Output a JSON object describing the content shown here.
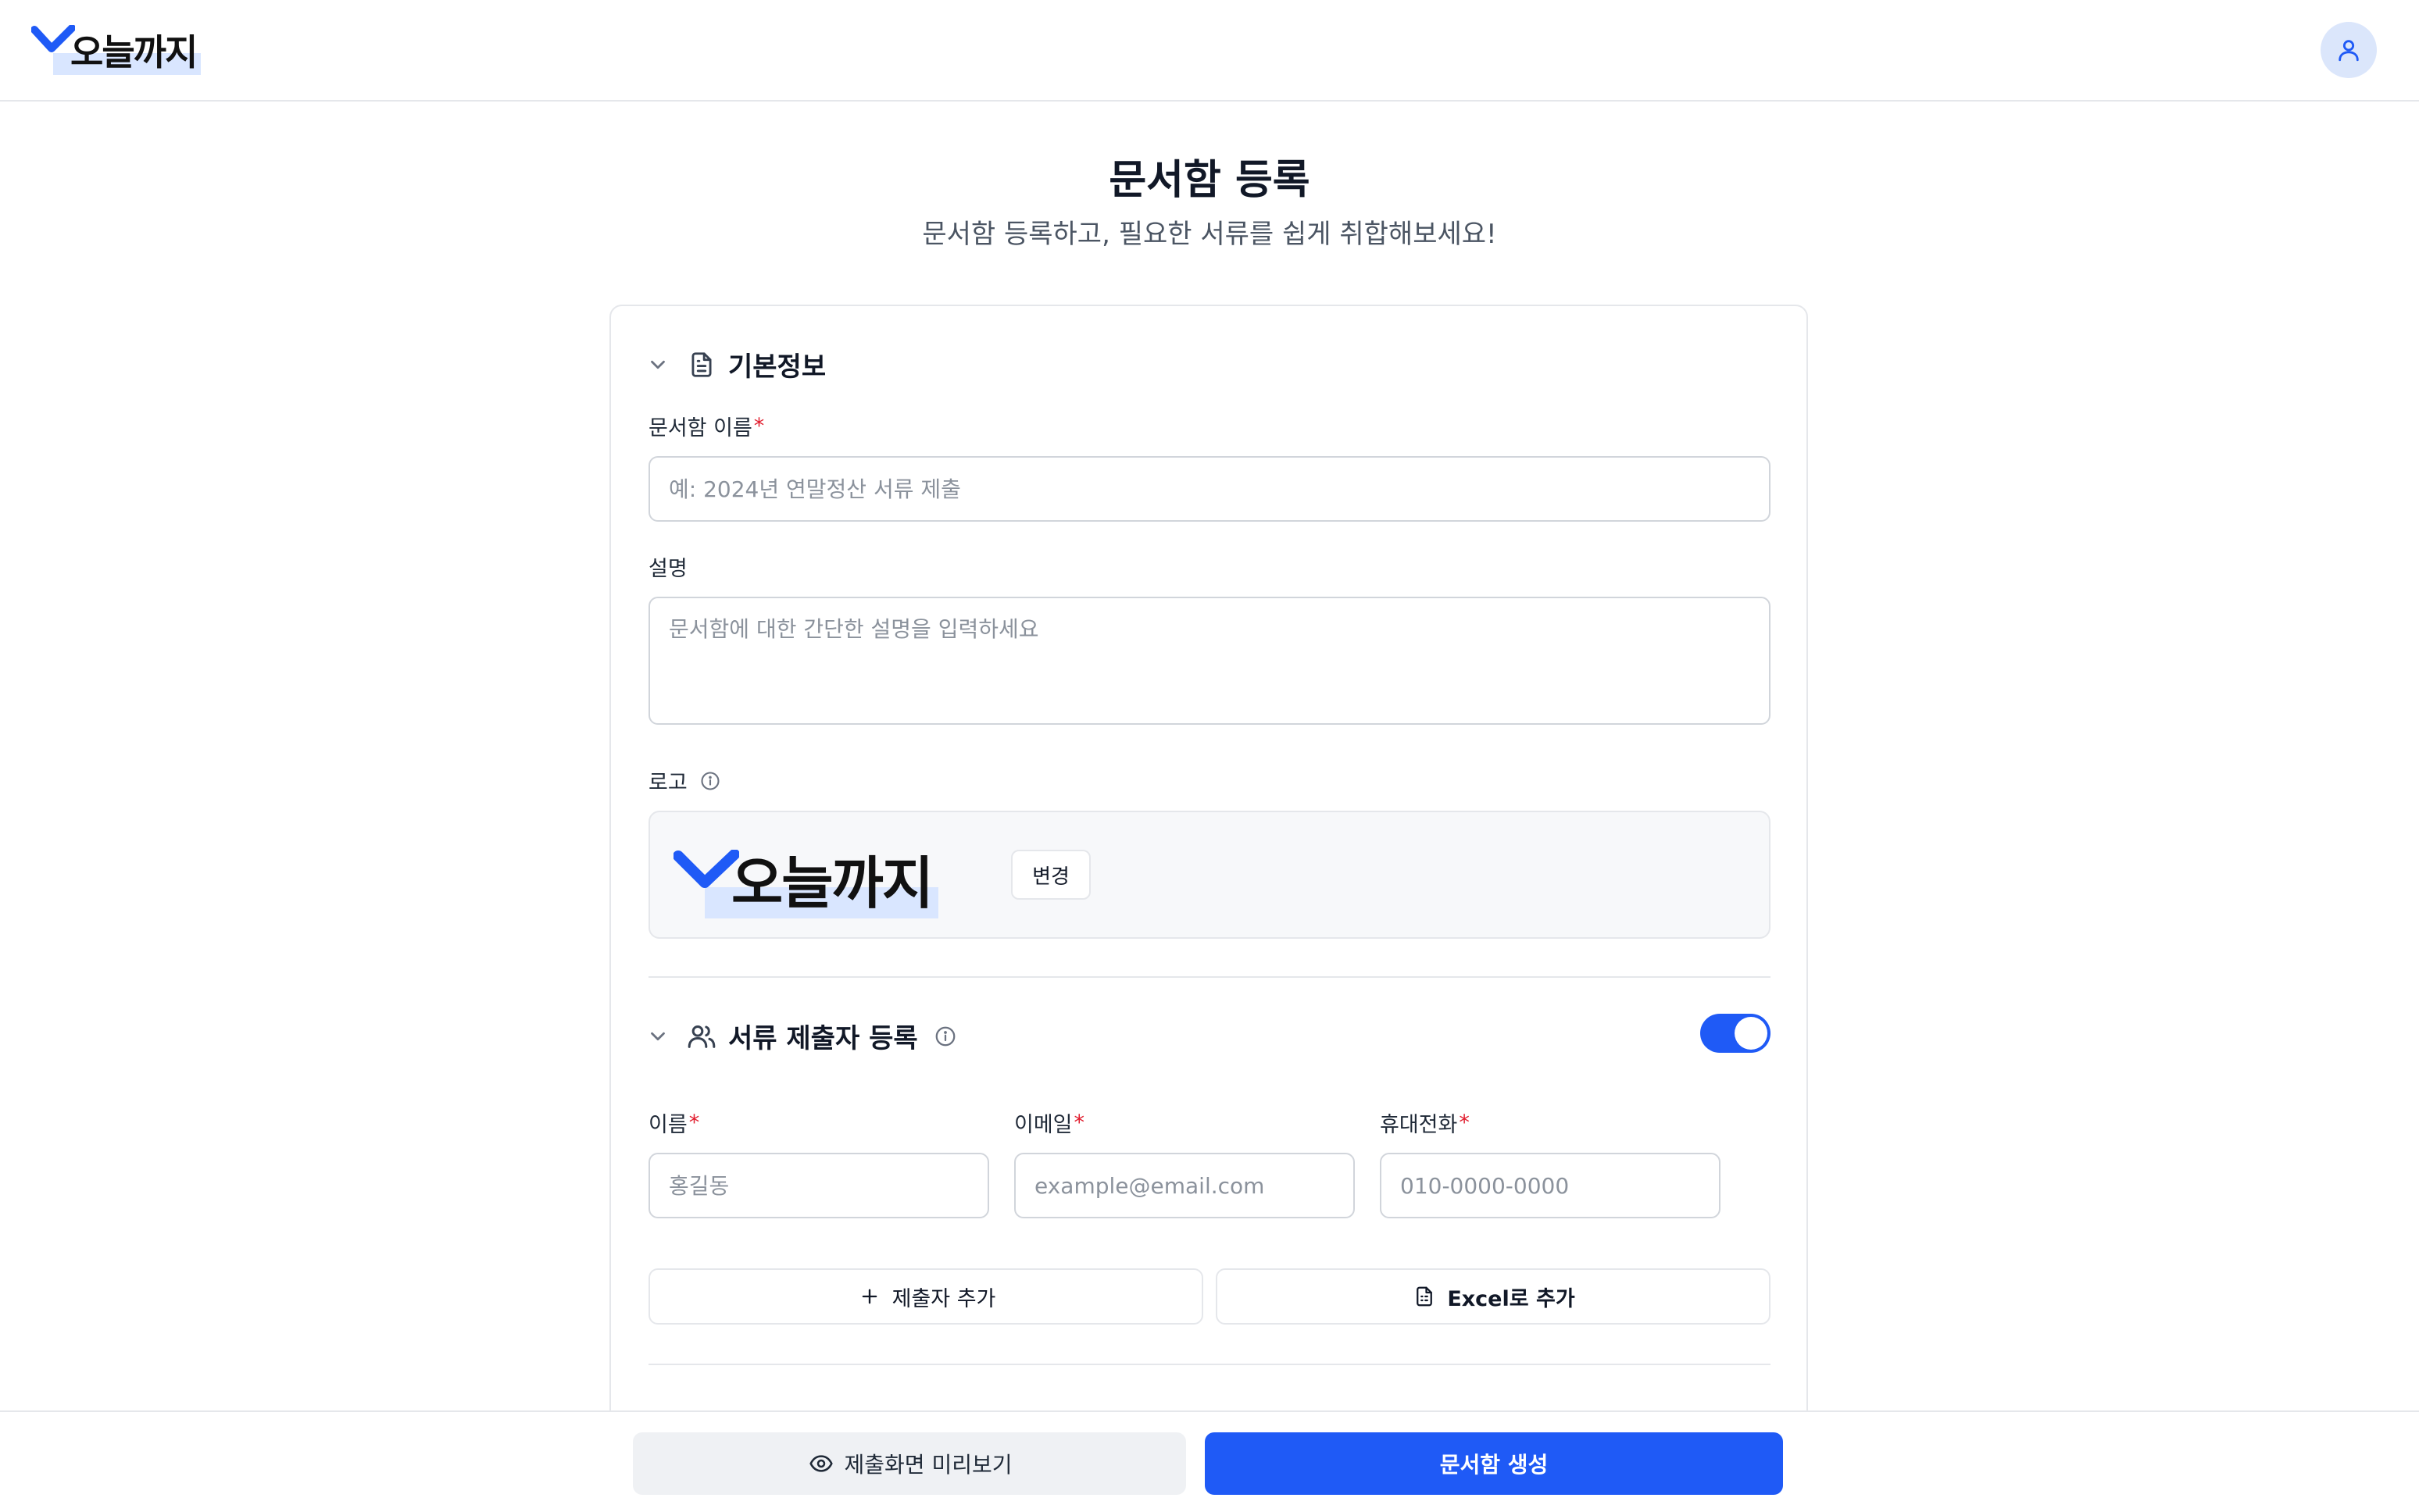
{
  "header": {
    "logo_text": "오늘까지",
    "avatar_icon": "user-icon"
  },
  "page": {
    "title": "문서함 등록",
    "subtitle": "문서함 등록하고, 필요한 서류를 쉽게 취합해보세요!"
  },
  "basic_info": {
    "section_title": "기본정보",
    "section_icon": "document-icon",
    "name_label": "문서함 이름",
    "required_mark": "*",
    "name_placeholder": "예: 2024년 연말정산 서류 제출",
    "name_value": "",
    "description_label": "설명",
    "description_placeholder": "문서함에 대한 간단한 설명을 입력하세요",
    "description_value": "",
    "logo_label": "로고",
    "logo_text": "오늘까지",
    "change_button": "변경"
  },
  "submitters": {
    "section_title": "서류 제출자 등록",
    "section_icon": "users-icon",
    "toggle_on": true,
    "name_label": "이름",
    "name_placeholder": "홍길동",
    "email_label": "이메일",
    "email_placeholder": "example@email.com",
    "phone_label": "휴대전화",
    "phone_placeholder": "010-0000-0000",
    "add_button": "제출자 추가",
    "excel_button": "Excel로 추가"
  },
  "footer": {
    "preview_button": "제출화면 미리보기",
    "create_button": "문서함 생성"
  },
  "colors": {
    "primary": "#1f5af6",
    "required": "#e11d2e",
    "logo_check": "#1f5af6",
    "logo_highlight": "#d9e6ff"
  }
}
